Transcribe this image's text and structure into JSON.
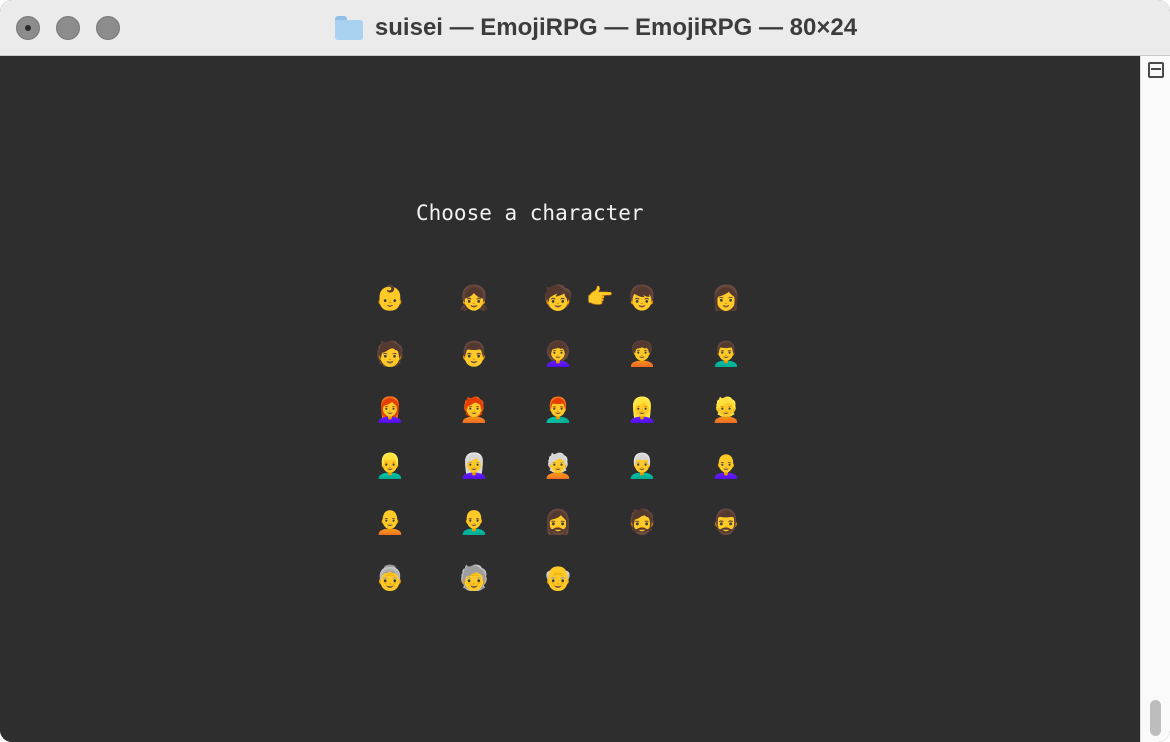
{
  "window": {
    "title": "suisei — EmojiRPG — EmojiRPG — 80×24",
    "traffic_lights": [
      "close-button",
      "minimize-button",
      "zoom-button"
    ]
  },
  "terminal": {
    "heading": "Choose a character",
    "pointer": "👉",
    "selected_index": 3,
    "rows": [
      [
        "👶",
        "👧",
        "🧒",
        "👦",
        "👩"
      ],
      [
        "🧑",
        "👨",
        "👩‍🦱",
        "🧑‍🦱",
        "👨‍🦱"
      ],
      [
        "👩‍🦰",
        "🧑‍🦰",
        "👨‍🦰",
        "👱‍♀️",
        "👱"
      ],
      [
        "👱‍♂️",
        "👩‍🦳",
        "🧑‍🦳",
        "👨‍🦳",
        "👩‍🦲"
      ],
      [
        "🧑‍🦲",
        "👨‍🦲",
        "🧔‍♀️",
        "🧔",
        "🧔‍♂️"
      ],
      [
        "👵",
        "🧓",
        "👴"
      ]
    ]
  },
  "colors": {
    "terminal_bg": "#2e2e2e",
    "terminal_text": "#f2f2f2",
    "titlebar_bg": "#ebebeb"
  }
}
